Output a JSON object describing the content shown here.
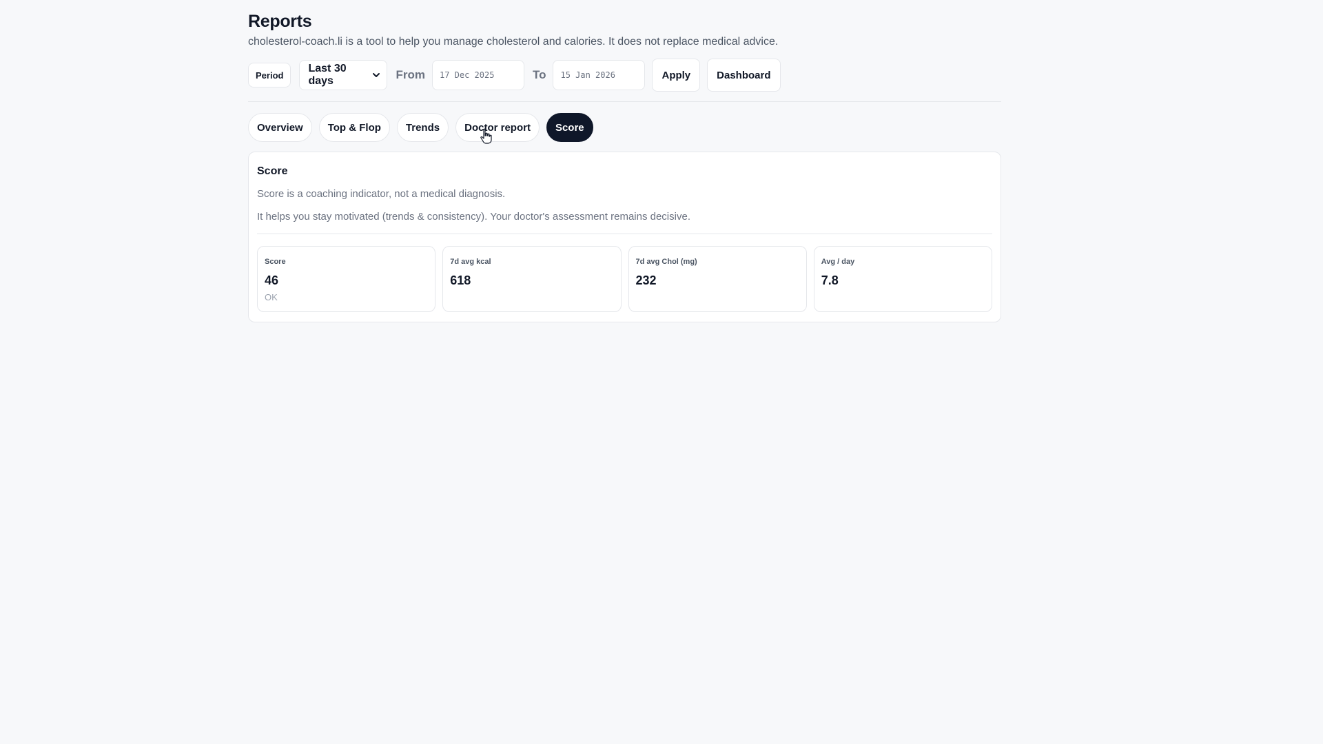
{
  "header": {
    "title": "Reports",
    "subtitle": "cholesterol-coach.li is a tool to help you manage cholesterol and calories. It does not replace medical advice."
  },
  "toolbar": {
    "period_label": "Period",
    "period_selected": "Last 30 days",
    "from_label": "From",
    "from_value": "17 Dec 2025",
    "to_label": "To",
    "to_value": "15 Jan 2026",
    "apply_label": "Apply",
    "dashboard_label": "Dashboard"
  },
  "tabs": [
    {
      "label": "Overview",
      "active": false
    },
    {
      "label": "Top & Flop",
      "active": false
    },
    {
      "label": "Trends",
      "active": false
    },
    {
      "label": "Doctor report",
      "active": false
    },
    {
      "label": "Score",
      "active": true
    }
  ],
  "score_card": {
    "title": "Score",
    "note1": "Score is a coaching indicator, not a medical diagnosis.",
    "note2": "It helps you stay motivated (trends & consistency). Your doctor's assessment remains decisive.",
    "kpis": [
      {
        "label": "Score",
        "value": "46",
        "sub": "OK"
      },
      {
        "label": "7d avg kcal",
        "value": "618",
        "sub": ""
      },
      {
        "label": "7d avg Chol (mg)",
        "value": "232",
        "sub": ""
      },
      {
        "label": "Avg / day",
        "value": "7.8",
        "sub": ""
      }
    ]
  },
  "colors": {
    "background": "#f7f8fa",
    "active_tab": "#0f1729",
    "border": "#e5e7eb",
    "muted_text": "#6b7280"
  },
  "icons": {
    "select_chevron": "chevron-down-icon",
    "cursor": "hand-pointer-icon"
  }
}
